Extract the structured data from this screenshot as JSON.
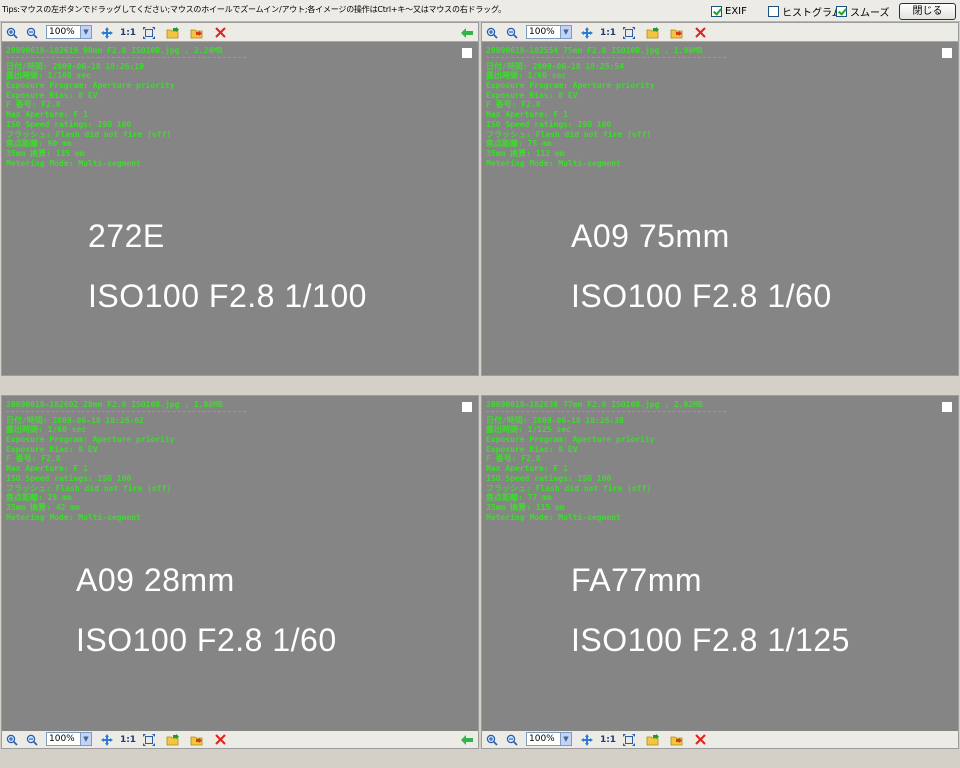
{
  "topbar": {
    "tip": "Tips:マウスの左ボタンでドラッグしてください;マウスのホイールでズームイン/アウト;各イメージの操作はCtrl+キ～又はマウスの右ドラッグ。",
    "checkboxes": [
      {
        "label": "EXIF",
        "checked": true
      },
      {
        "label": "ヒストグラム",
        "checked": false
      },
      {
        "label": "スムーズ",
        "checked": true
      }
    ],
    "close_label": "閉じる"
  },
  "pane_toolbar": {
    "zoom": "100%",
    "one_to_one": "1:1"
  },
  "panes": [
    {
      "filename_line": "20090618-182619 90mm F2.8 ISO100.jpg , 2.24MB",
      "exif": [
        "日付/時間: 2009-06-18 18:26:19",
        "露出時間: 1/100 sec",
        "Exposure Program: Aperture priority",
        "Exposure Bias: 0 EV",
        "F 番号: F2.8",
        "Max Aperture: F 1",
        "ISO Speed ratings: ISO 100",
        "フラッシュ: Flash did not fire [off]",
        "焦点距離: 90 mm",
        "35mm 換算: 135 mm",
        "Metering Mode: Multi-segment"
      ],
      "big_line1": "272E",
      "big_line2": "ISO100  F2.8  1/100"
    },
    {
      "filename_line": "20090618-182554 75mm F2.8 ISO100.jpg , 1.90MB",
      "exif": [
        "日付/時間: 2009-06-18 18:25:54",
        "露出時間: 1/60 sec",
        "Exposure Program: Aperture priority",
        "Exposure Bias: 0 EV",
        "F 番号: F2.8",
        "Max Aperture: F 1",
        "ISO Speed ratings: ISO 100",
        "フラッシュ: Flash did not fire [off]",
        "焦点距離: 75 mm",
        "35mm 換算: 112 mm",
        "Metering Mode: Multi-segment"
      ],
      "big_line1": "A09  75mm",
      "big_line2": "ISO100  F2.8  1/60"
    },
    {
      "filename_line": "20090618-182602 28mm F2.8 ISO100.jpg , 1.88MB",
      "exif": [
        "日付/時間: 2009-06-18 18:26:02",
        "露出時間: 1/60 sec",
        "Exposure Program: Aperture priority",
        "Exposure Bias: 0 EV",
        "F 番号: F2.8",
        "Max Aperture: F 1",
        "ISO Speed ratings: ISO 100",
        "フラッシュ: Flash did not fire [off]",
        "焦点距離: 28 mm",
        "35mm 換算: 42 mm",
        "Metering Mode: Multi-segment"
      ],
      "big_line1": "A09  28mm",
      "big_line2": "ISO100  F2.8  1/60"
    },
    {
      "filename_line": "20090618-182638 77mm F2.8 ISO100.jpg , 2.02MB",
      "exif": [
        "日付/時間: 2009-06-18 18:26:38",
        "露出時間: 1/125 sec",
        "Exposure Program: Aperture priority",
        "Exposure Bias: 0 EV",
        "F 番号: F2.8",
        "Max Aperture: F 1",
        "ISO Speed ratings: ISO 100",
        "フラッシュ: Flash did not fire [off]",
        "焦点距離: 77 mm",
        "35mm 換算: 115 mm",
        "Metering Mode: Multi-segment"
      ],
      "big_line1": "FA77mm",
      "big_line2": "ISO100  F2.8  1/125"
    }
  ],
  "icons": {
    "zoom_in": "zoom-in-icon",
    "zoom_out": "zoom-out-icon",
    "move": "move-icon",
    "fit": "fit-window-icon",
    "open": "open-folder-icon",
    "save": "save-icon",
    "remove": "remove-icon",
    "back": "back-arrow-icon"
  },
  "colors": {
    "exif_text": "#3ddc2d",
    "pane_bg": "#858585",
    "remove_icon": "#e0201c"
  }
}
